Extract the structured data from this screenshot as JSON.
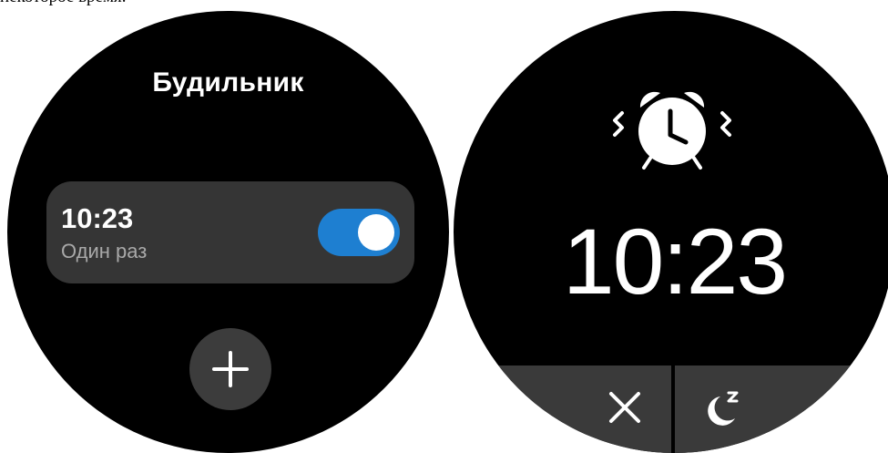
{
  "caption_fragment": "некоторое время.",
  "alarm_list": {
    "title": "Будильник",
    "alarms": [
      {
        "time": "10:23",
        "repeat": "Один раз",
        "enabled": true
      }
    ],
    "toggle_color": "#1e7fd1",
    "add_icon": "plus-icon"
  },
  "ringing": {
    "icon": "alarm-clock-ringing-icon",
    "time": "10:23",
    "actions": [
      {
        "name": "dismiss",
        "icon": "close-icon"
      },
      {
        "name": "snooze",
        "icon": "moon-zz-icon"
      }
    ]
  }
}
